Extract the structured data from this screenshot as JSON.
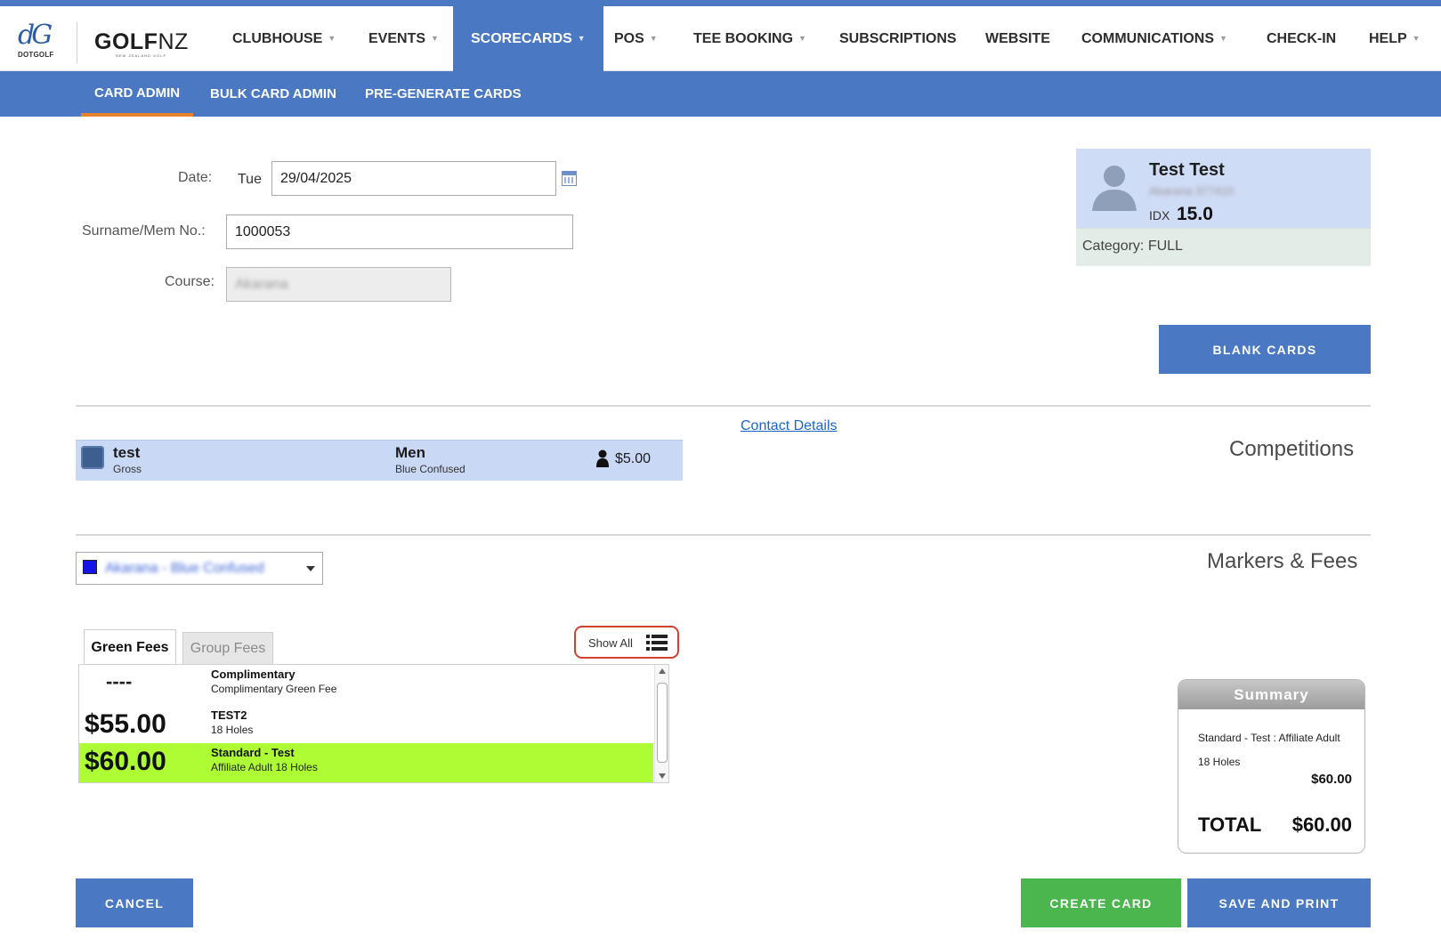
{
  "brand": {
    "dotgolf_label": "DOTGOLF",
    "golf": "GOLF",
    "nz": "NZ",
    "tagline": "NEW ZEALAND GOLF"
  },
  "nav": {
    "items": [
      {
        "label": "CLUBHOUSE"
      },
      {
        "label": "EVENTS"
      },
      {
        "label": "SCORECARDS"
      },
      {
        "label": "POS"
      },
      {
        "label": "TEE BOOKING"
      },
      {
        "label": "SUBSCRIPTIONS"
      },
      {
        "label": "WEBSITE"
      },
      {
        "label": "COMMUNICATIONS"
      },
      {
        "label": "CHECK-IN"
      },
      {
        "label": "HELP"
      }
    ],
    "active": "SCORECARDS"
  },
  "subnav": {
    "items": [
      {
        "label": "CARD ADMIN"
      },
      {
        "label": "BULK CARD ADMIN"
      },
      {
        "label": "PRE-GENERATE CARDS"
      }
    ],
    "active": "CARD ADMIN"
  },
  "form": {
    "date_label": "Date:",
    "day": "Tue",
    "date_value": "29/04/2025",
    "member_label": "Surname/Mem No.:",
    "member_value": "1000053",
    "course_label": "Course:",
    "course_value": "Akarana"
  },
  "member": {
    "name": "Test Test",
    "club_blurred": "Akarana 377410",
    "idx_label": "IDX",
    "idx_value": "15.0",
    "category": "Category: FULL"
  },
  "buttons": {
    "blank_cards": "BLANK CARDS",
    "cancel": "CANCEL",
    "create_card": "CREATE CARD",
    "save_and_print": "SAVE AND PRINT"
  },
  "competitions": {
    "title": "Competitions",
    "contact_link": "Contact Details",
    "rows": [
      {
        "name": "test",
        "type": "Gross",
        "division": "Men",
        "tee": "Blue Confused",
        "fee": "$5.00",
        "color": "#3d5f8f"
      }
    ]
  },
  "markers": {
    "title": "Markers & Fees",
    "selected": "Akarana - Blue Confused",
    "swatch_color": "#1414e6"
  },
  "fees": {
    "tabs": [
      {
        "label": "Green Fees",
        "active": true
      },
      {
        "label": "Group Fees",
        "active": false
      }
    ],
    "show_all": "Show All",
    "rows": [
      {
        "price": "----",
        "name": "Complimentary",
        "desc": "Complimentary Green Fee",
        "selected": false
      },
      {
        "price": "$55.00",
        "name": "TEST2",
        "desc": "18 Holes",
        "selected": false
      },
      {
        "price": "$60.00",
        "name": "Standard - Test",
        "desc": "Affiliate Adult 18 Holes",
        "selected": true
      }
    ],
    "highlight_color": "#aefc34"
  },
  "summary": {
    "title": "Summary",
    "item_line1": "Standard - Test : Affiliate Adult",
    "item_line2": "18 Holes",
    "item_amount": "$60.00",
    "total_label": "TOTAL",
    "total_value": "$60.00"
  },
  "colors": {
    "primary": "#4a78c2",
    "accent": "#e8832a",
    "success": "#4bb54e",
    "alert_outline": "#d24030"
  }
}
